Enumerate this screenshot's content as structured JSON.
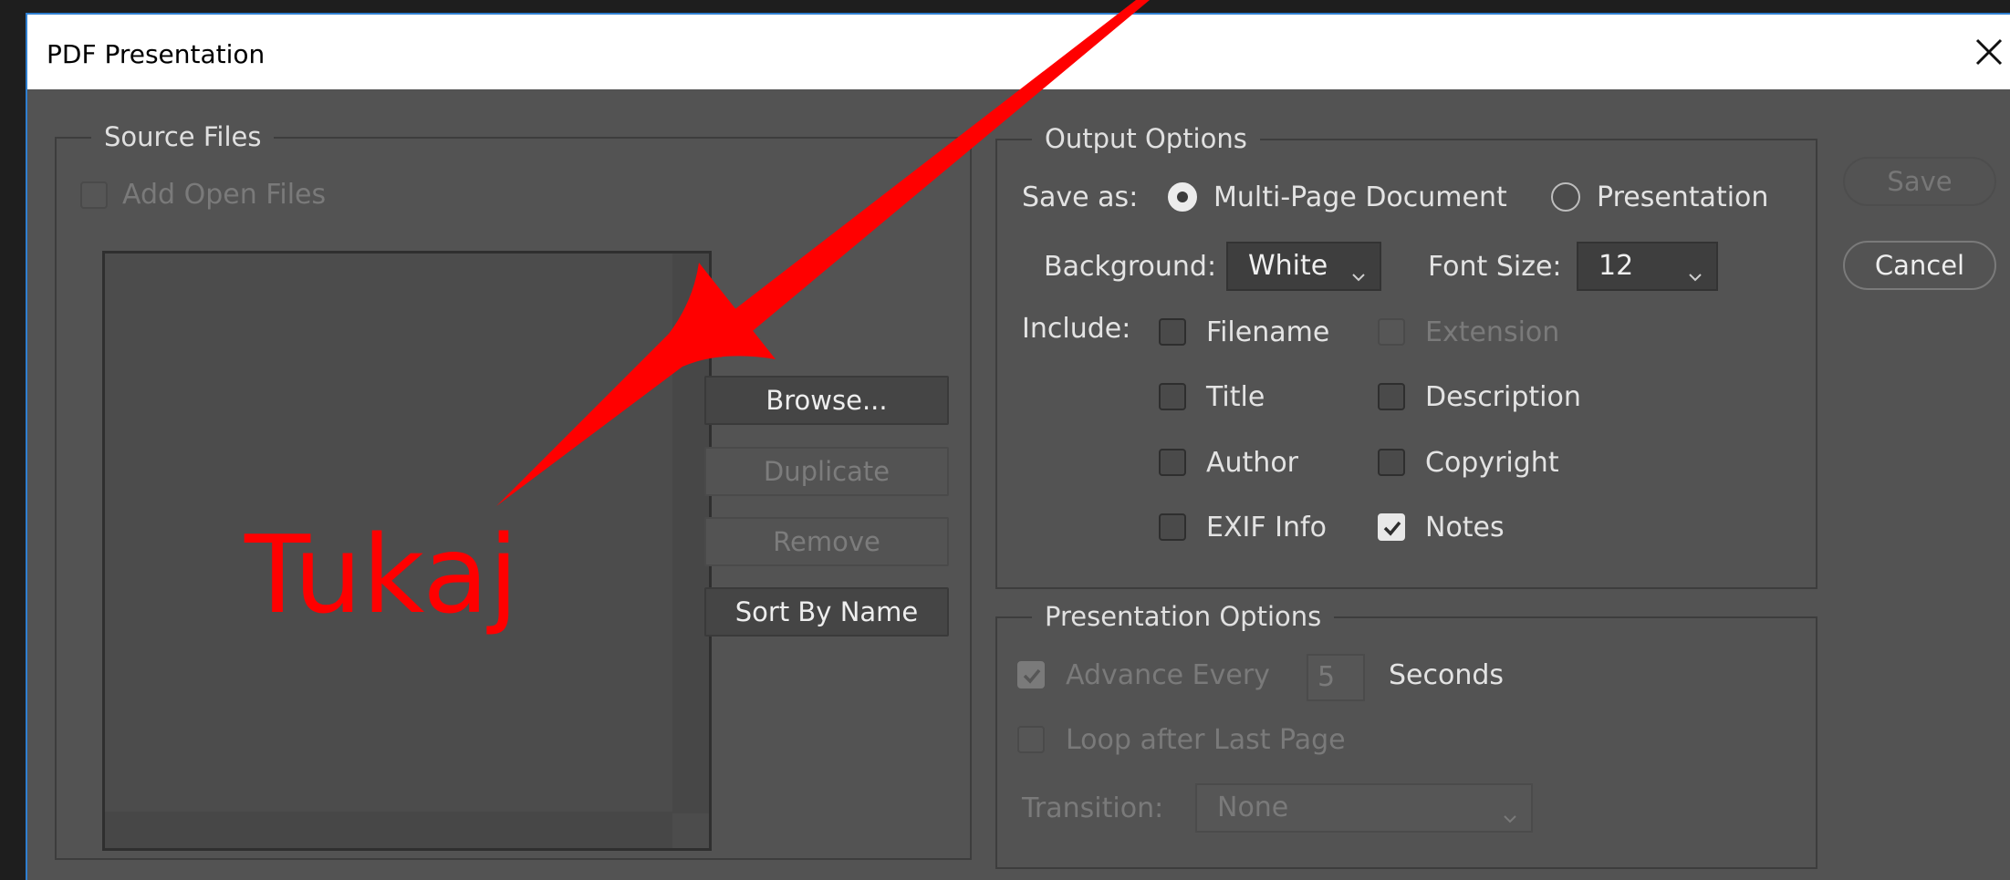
{
  "window": {
    "title": "PDF Presentation"
  },
  "source_files": {
    "label": "Source Files",
    "add_open_files": "Add Open Files",
    "buttons": {
      "browse": "Browse...",
      "duplicate": "Duplicate",
      "remove": "Remove",
      "sort": "Sort By Name"
    }
  },
  "output_options": {
    "label": "Output Options",
    "save_as_label": "Save as:",
    "multi_page": "Multi-Page Document",
    "presentation": "Presentation",
    "background_label": "Background:",
    "background_value": "White",
    "font_size_label": "Font Size:",
    "font_size_value": "12",
    "include_label": "Include:",
    "filename": "Filename",
    "extension": "Extension",
    "title": "Title",
    "description": "Description",
    "author": "Author",
    "copyright": "Copyright",
    "exif": "EXIF Info",
    "notes": "Notes"
  },
  "presentation_options": {
    "label": "Presentation Options",
    "advance_every": "Advance Every",
    "advance_value": "5",
    "seconds": "Seconds",
    "loop": "Loop after Last Page",
    "transition_label": "Transition:",
    "transition_value": "None"
  },
  "actions": {
    "save": "Save",
    "cancel": "Cancel"
  },
  "annotation": {
    "text": "Tukaj",
    "color": "#ff0000"
  }
}
